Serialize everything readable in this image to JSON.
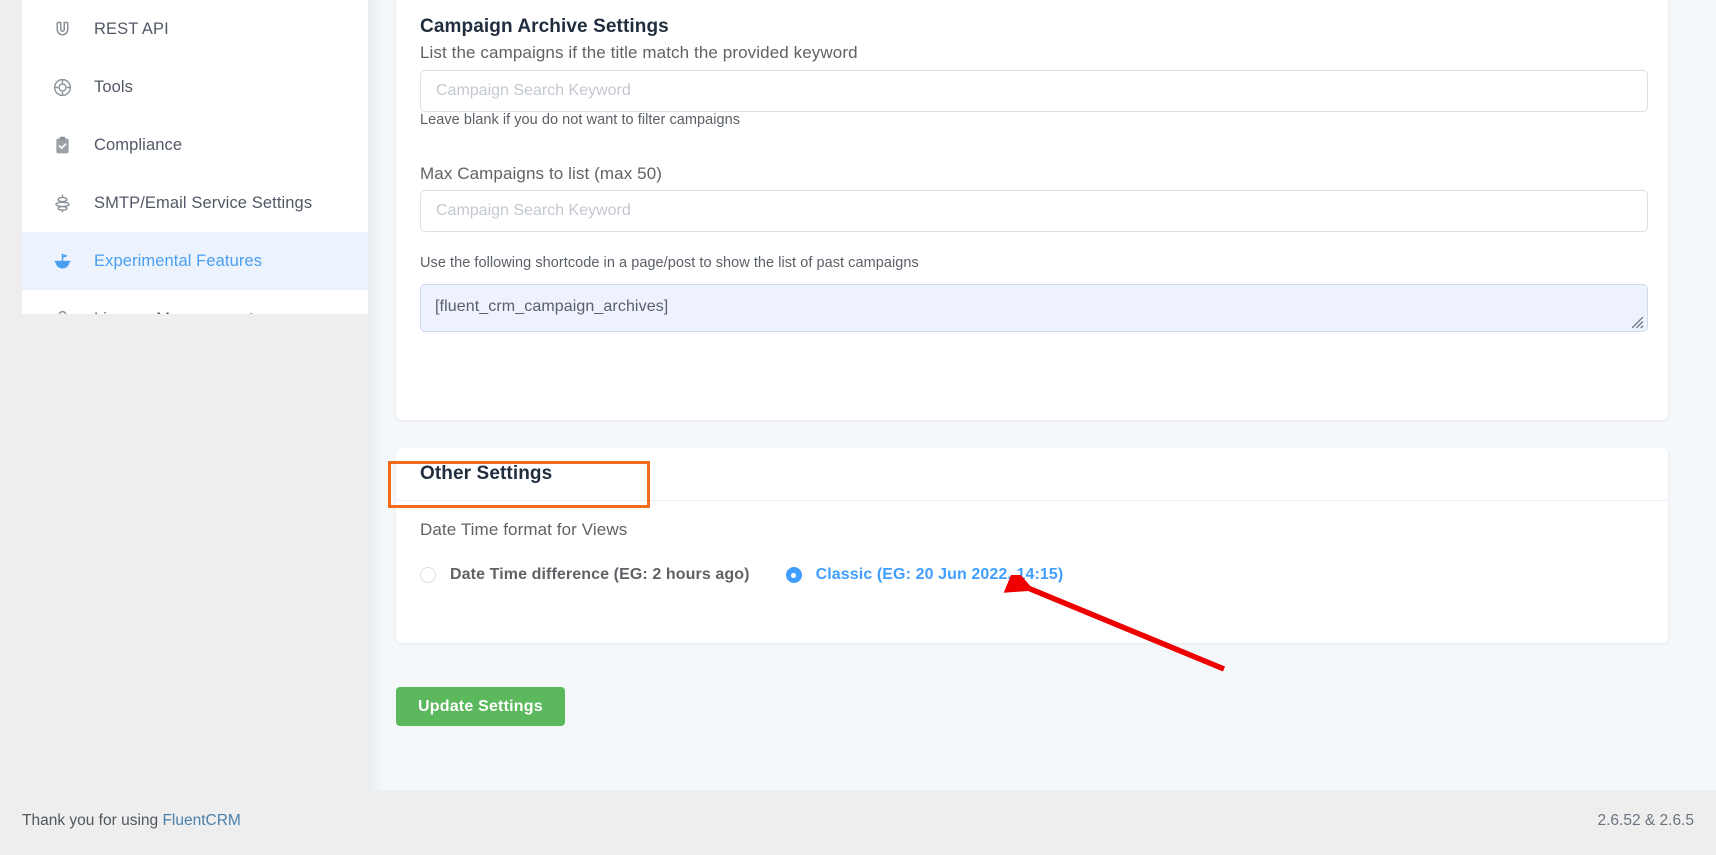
{
  "sidebar": {
    "items": [
      {
        "label": "REST API",
        "icon": "magnet-icon",
        "active": false
      },
      {
        "label": "Tools",
        "icon": "lifebuoy-icon",
        "active": false
      },
      {
        "label": "Compliance",
        "icon": "clipboard-check-icon",
        "active": false
      },
      {
        "label": "SMTP/Email Service Settings",
        "icon": "server-stack-icon",
        "active": false
      },
      {
        "label": "Experimental Features",
        "icon": "flask-icon",
        "active": true
      },
      {
        "label": "License Management",
        "icon": "lock-icon",
        "active": false
      }
    ]
  },
  "archive_card": {
    "title": "Campaign Archive Settings",
    "keyword_label": "List the campaigns if the title match the provided keyword",
    "keyword_placeholder": "Campaign Search Keyword",
    "keyword_value": "",
    "keyword_help": "Leave blank if you do not want to filter campaigns",
    "max_label": "Max Campaigns to list (max 50)",
    "max_placeholder": "Campaign Search Keyword",
    "max_value": "",
    "shortcode_help": "Use the following shortcode in a page/post to show the list of past campaigns",
    "shortcode_value": "[fluent_crm_campaign_archives]"
  },
  "other_card": {
    "title": "Other Settings",
    "datetime_label": "Date Time format for Views",
    "options": [
      {
        "label": "Date Time difference (EG: 2 hours ago)",
        "selected": false
      },
      {
        "label": "Classic (EG: 20 Jun 2022, 14:15)",
        "selected": true
      }
    ]
  },
  "actions": {
    "update_label": "Update Settings"
  },
  "footer": {
    "thanks_prefix": "Thank you for using ",
    "brand": "FluentCRM",
    "versions": "2.6.52 & 2.6.5"
  },
  "annotations": {
    "highlight_target": "Other Settings",
    "arrow_target": "Classic (EG: 20 Jun 2022, 14:15)"
  },
  "colors": {
    "accent_blue": "#409eff",
    "active_bg": "#ecf3fd",
    "button_green": "#5cb85c",
    "annotation_orange": "#f26a1b",
    "annotation_red": "#ee0000",
    "shortcode_bg": "#edf2fd"
  }
}
